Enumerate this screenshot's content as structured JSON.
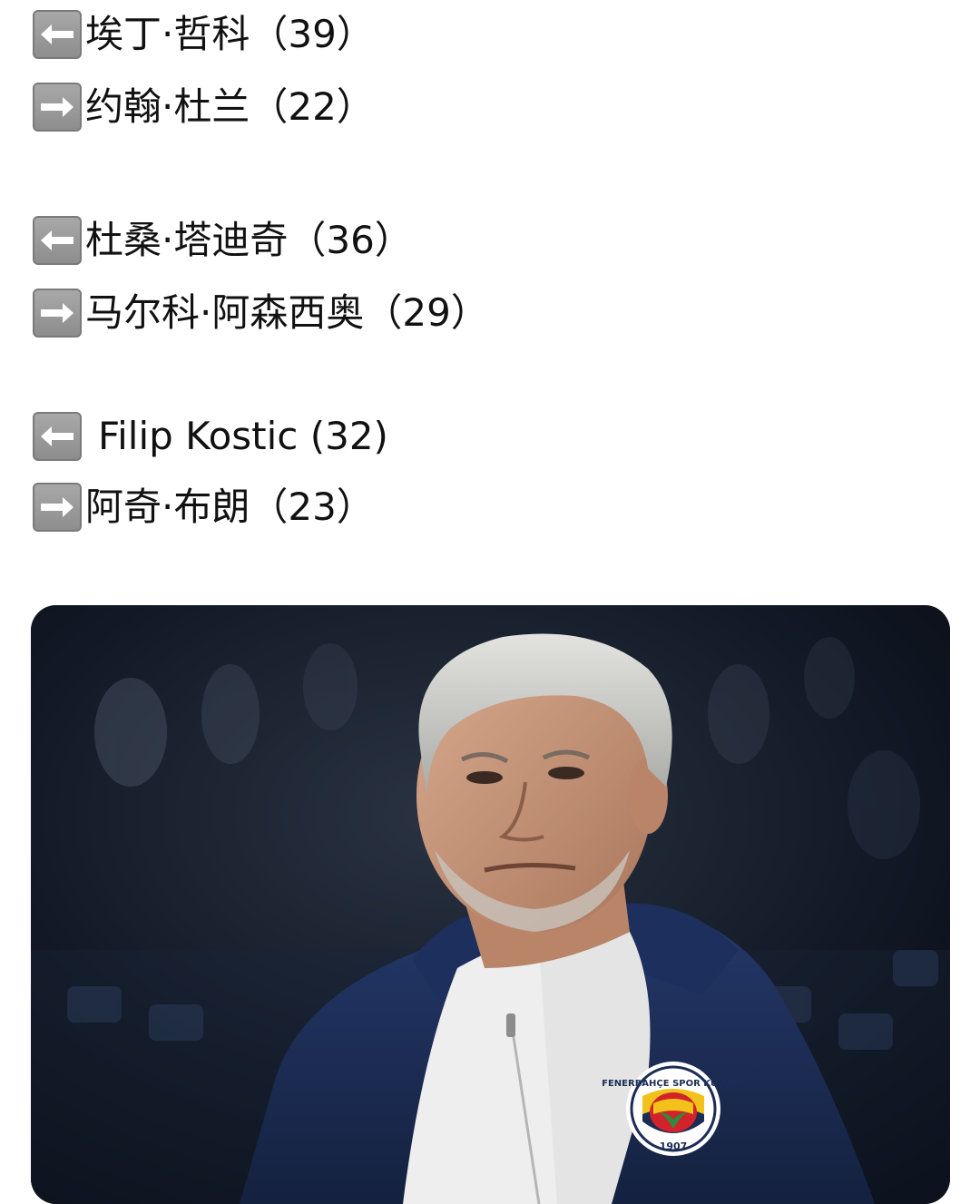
{
  "lines": [
    {
      "arrow": "left-arrow-icon",
      "text": "埃丁·哲科（39）"
    },
    {
      "arrow": "right-arrow-icon",
      "text": "约翰·杜兰（22）"
    },
    {
      "arrow": "left-arrow-icon",
      "text": "杜桑·塔迪奇（36）"
    },
    {
      "arrow": "right-arrow-icon",
      "text": "马尔科·阿森西奥（29）"
    },
    {
      "arrow": "left-arrow-icon",
      "text": "Filip Kostic (32)"
    },
    {
      "arrow": "right-arrow-icon",
      "text": "阿奇·布朗（23）"
    }
  ],
  "photo": {
    "badge_text": "FENERBAHÇE SPOR KULÜBÜ",
    "badge_year": "1907",
    "colors": {
      "jacket": "#1c2c55",
      "badge_yellow": "#f2c21a",
      "badge_red": "#d2232a",
      "badge_green": "#2f8a3c"
    }
  }
}
